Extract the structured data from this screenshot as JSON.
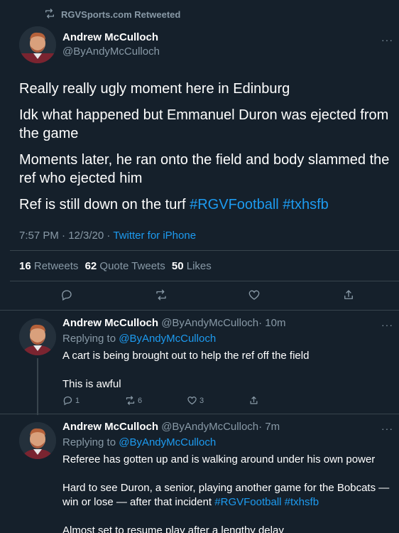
{
  "retweet_header": {
    "text": "RGVSports.com Retweeted",
    "icon": "retweet-icon"
  },
  "main_tweet": {
    "author_name": "Andrew McCulloch",
    "author_handle": "@ByAndyMcCulloch",
    "paragraphs": [
      "Really really ugly moment here in Edinburg",
      "Idk what happened but Emmanuel Duron was ejected from the game",
      "Moments later, he ran onto the field and body slammed the ref who ejected him"
    ],
    "last_paragraph_text": "Ref is still down on the turf ",
    "hashtags": [
      "#RGVFootball",
      "#txhsfb"
    ],
    "timestamp": "7:57 PM · 12/3/20 · ",
    "source": "Twitter for iPhone",
    "retweets_count": "16",
    "retweets_label": "Retweets",
    "quotes_count": "62",
    "quotes_label": "Quote Tweets",
    "likes_count": "50",
    "likes_label": "Likes"
  },
  "replies": [
    {
      "author_name": "Andrew McCulloch",
      "author_handle": "@ByAndyMcCulloch",
      "time": "· 10m",
      "replying_label": "Replying to ",
      "replying_handle": "@ByAndyMcCulloch",
      "paragraphs": [
        "A cart is being brought out to help the ref off the field",
        "This is awful"
      ],
      "reply_count": "1",
      "retweet_count": "6",
      "like_count": "3"
    },
    {
      "author_name": "Andrew McCulloch",
      "author_handle": "@ByAndyMcCulloch",
      "time": "· 7m",
      "replying_label": "Replying to ",
      "replying_handle": "@ByAndyMcCulloch",
      "para1": "Referee has gotten up and is walking around under his own power",
      "para2_text": "Hard to see Duron, a senior, playing another game for the Bobcats — win or lose — after that incident ",
      "para2_hashtags": [
        "#RGVFootball",
        "#txhsfb"
      ],
      "para3": "Almost set to resume play after a lengthy delay"
    }
  ],
  "more_icon": "more-horizontal-icon",
  "colors": {
    "background": "#15202b",
    "text": "#ffffff",
    "muted": "#8899a6",
    "accent": "#1d9bf0",
    "divider": "#38444d"
  }
}
